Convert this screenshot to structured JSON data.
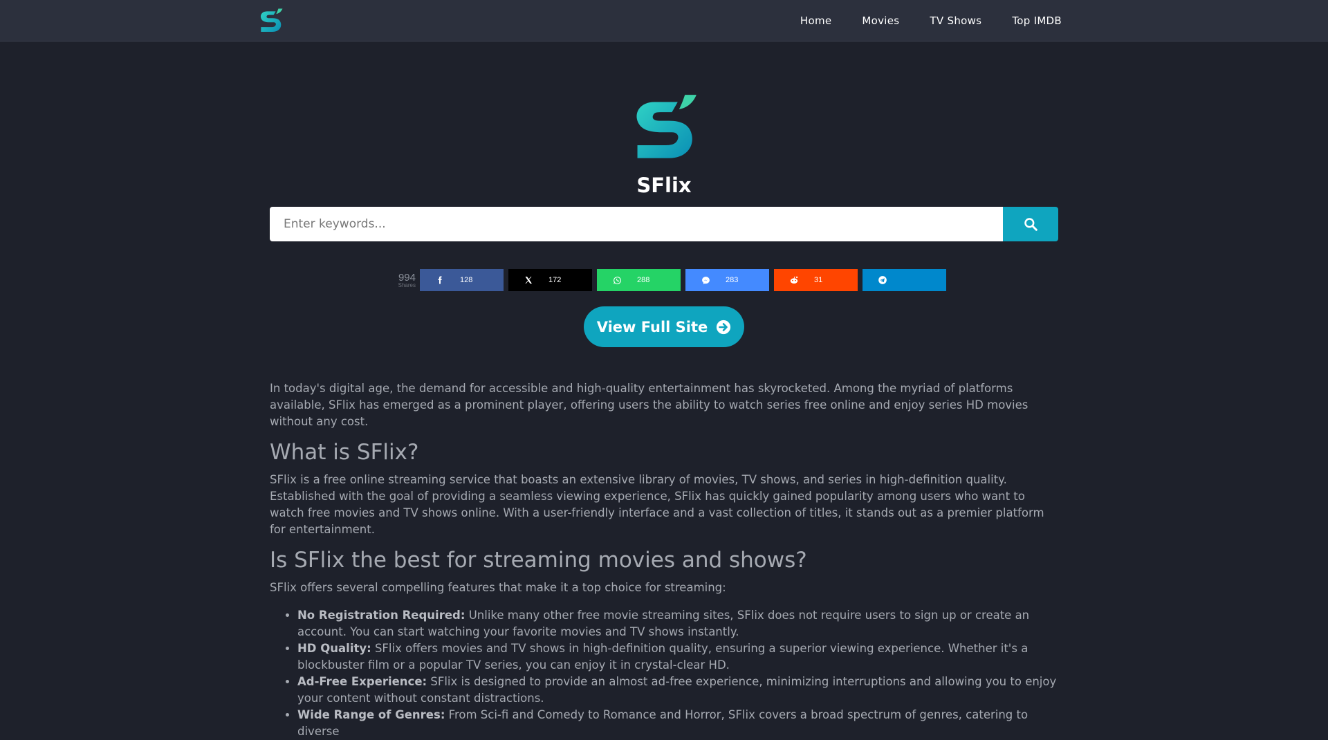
{
  "header": {
    "logo_icon": "sflix-logo-icon",
    "nav": [
      "Home",
      "Movies",
      "TV Shows",
      "Top IMDB"
    ]
  },
  "hero": {
    "title": "SFlix",
    "logo_icon": "sflix-logo-icon"
  },
  "search": {
    "placeholder": "Enter keywords...",
    "value": "",
    "button_icon": "search-icon"
  },
  "shares": {
    "total": "994",
    "total_label": "Shares",
    "buttons": [
      {
        "network": "facebook",
        "icon": "facebook-icon",
        "count": "128",
        "color": "#3b5998"
      },
      {
        "network": "x",
        "icon": "x-icon",
        "count": "172",
        "color": "#000000"
      },
      {
        "network": "whatsapp",
        "icon": "whatsapp-icon",
        "count": "288",
        "color": "#25d366"
      },
      {
        "network": "messenger",
        "icon": "messenger-icon",
        "count": "283",
        "color": "#448aff"
      },
      {
        "network": "reddit",
        "icon": "reddit-icon",
        "count": "31",
        "color": "#ff4500"
      },
      {
        "network": "telegram",
        "icon": "telegram-icon",
        "count": "",
        "color": "#0088cc"
      }
    ]
  },
  "cta": {
    "label": "View Full Site",
    "icon": "arrow-circle-right-icon"
  },
  "article": {
    "intro": "In today's digital age, the demand for accessible and high-quality entertainment has skyrocketed. Among the myriad of platforms available, SFlix has emerged as a prominent player, offering users the ability to watch series free online and enjoy series HD movies without any cost.",
    "h2_what": "What is SFlix?",
    "what_text": "SFlix is a free online streaming service that boasts an extensive library of movies, TV shows, and series in high-definition quality. Established with the goal of providing a seamless viewing experience, SFlix has quickly gained popularity among users who want to watch free movies and TV shows online. With a user-friendly interface and a vast collection of titles, it stands out as a premier platform for entertainment.",
    "h2_best": "Is SFlix the best for streaming movies and shows?",
    "best_text": "SFlix offers several compelling features that make it a top choice for streaming:",
    "features": [
      {
        "title": "No Registration Required:",
        "text": " Unlike many other free movie streaming sites, SFlix does not require users to sign up or create an account. You can start watching your favorite movies and TV shows instantly."
      },
      {
        "title": "HD Quality:",
        "text": " SFlix offers movies and TV shows in high-definition quality, ensuring a superior viewing experience. Whether it's a blockbuster film or a popular TV series, you can enjoy it in crystal-clear HD."
      },
      {
        "title": "Ad-Free Experience:",
        "text": " SFlix is designed to provide an almost ad-free experience, minimizing interruptions and allowing you to enjoy your content without constant distractions."
      },
      {
        "title": "Wide Range of Genres:",
        "text": " From Sci-fi and Comedy to Romance and Horror, SFlix covers a broad spectrum of genres, catering to diverse"
      }
    ]
  },
  "colors": {
    "background": "#1e212b",
    "topbar": "#2c303d",
    "accent": "#0fa5bf"
  }
}
